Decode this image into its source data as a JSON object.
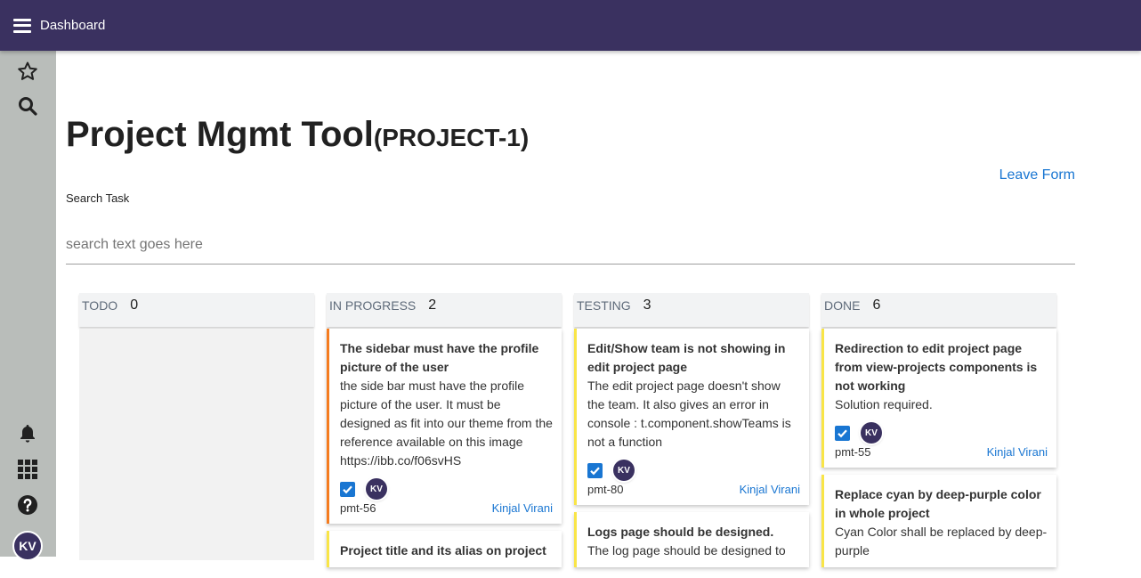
{
  "topbar": {
    "title": "Dashboard"
  },
  "sidebar": {
    "top_icons": [
      "star-icon",
      "search-icon"
    ],
    "bottom_icons": [
      "bell-icon",
      "apps-grid-icon",
      "help-icon"
    ],
    "avatar": "KV"
  },
  "page": {
    "title": "Project Mgmt Tool",
    "project_key": "(PROJECT-1)",
    "leave_form": "Leave Form",
    "search_label": "Search Task",
    "search_placeholder": "search text goes here"
  },
  "board": {
    "columns": [
      {
        "name": "TODO",
        "count": "0",
        "cards": []
      },
      {
        "name": "IN PROGRESS",
        "count": "2",
        "cards": [
          {
            "title": "The sidebar must have the profile picture of the user",
            "description": "the side bar must have the profile picture of the user. It must be designed as fit into our theme from the reference available on this image https://ibb.co/f06svHS",
            "avatar": "KV",
            "id": "pmt-56",
            "assignee": "Kinjal Virani",
            "accent": "#f57c1f"
          },
          {
            "title": "Project title and its alias on project",
            "description": "",
            "accent": "#f9e547"
          }
        ]
      },
      {
        "name": "TESTING",
        "count": "3",
        "cards": [
          {
            "title": "Edit/Show team is not showing in edit project page",
            "description": "The edit project page doesn't show the team. It also gives an error in console : t.component.showTeams is not a function",
            "avatar": "KV",
            "id": "pmt-80",
            "assignee": "Kinjal Virani",
            "accent": "#f9e547"
          },
          {
            "title": "Logs page should be designed.",
            "description": "The log page should be designed to",
            "accent": "#f9e547"
          }
        ]
      },
      {
        "name": "DONE",
        "count": "6",
        "cards": [
          {
            "title": "Redirection to edit project page from view-projects components is not working",
            "description": "Solution required.",
            "avatar": "KV",
            "id": "pmt-55",
            "assignee": "Kinjal Virani",
            "accent": "#f9e547"
          },
          {
            "title": "Replace cyan by deep-purple color in whole project",
            "description": "Cyan Color shall be replaced by deep-purple",
            "accent": "#f9e547"
          }
        ]
      }
    ]
  },
  "colors": {
    "topbar": "#3a3160",
    "sidebar": "#b9bdba",
    "link": "#1976d2",
    "in_progress_accent": "#f57c1f",
    "card_accent": "#f9e547"
  }
}
